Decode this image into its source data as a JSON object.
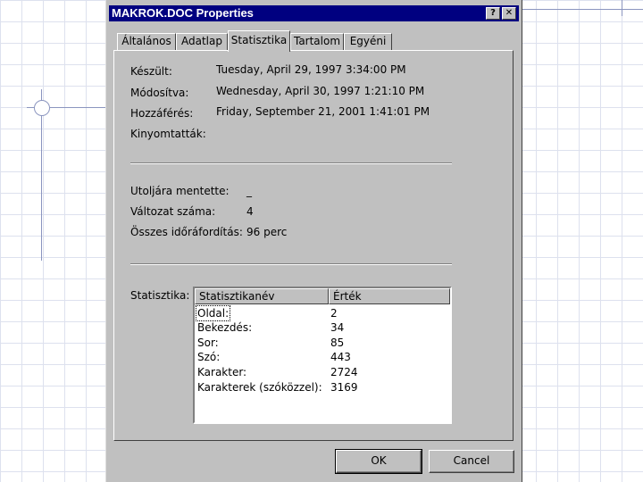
{
  "window": {
    "title": "MAKROK.DOC Properties",
    "help_label": "?",
    "close_label": "✕"
  },
  "tabs": [
    {
      "label": "Általános"
    },
    {
      "label": "Adatlap"
    },
    {
      "label": "Statisztika",
      "active": true
    },
    {
      "label": "Tartalom"
    },
    {
      "label": "Egyéni"
    }
  ],
  "dates": {
    "created_label": "Készült:",
    "created_value": "Tuesday, April 29, 1997 3:34:00 PM",
    "modified_label": "Módosítva:",
    "modified_value": "Wednesday, April 30, 1997 1:21:10 PM",
    "accessed_label": "Hozzáférés:",
    "accessed_value": "Friday, September 21, 2001 1:41:01 PM",
    "printed_label": "Kinyomtatták:",
    "printed_value": ""
  },
  "revision": {
    "last_saved_label": "Utoljára mentette:",
    "last_saved_value": "_",
    "revision_label": "Változat száma:",
    "revision_value": "4",
    "editing_label": "Összes időráfordítás:",
    "editing_value": "96 perc"
  },
  "statistics": {
    "label": "Statisztika:",
    "col_name": "Statisztikanév",
    "col_value": "Érték",
    "rows": [
      {
        "name": "Oldal:",
        "value": "2"
      },
      {
        "name": "Bekezdés:",
        "value": "34"
      },
      {
        "name": "Sor:",
        "value": "85"
      },
      {
        "name": "Szó:",
        "value": "443"
      },
      {
        "name": "Karakter:",
        "value": "2724"
      },
      {
        "name": "Karakterek (szóközzel):",
        "value": "3169"
      }
    ]
  },
  "buttons": {
    "ok_label": "OK",
    "cancel_label": "Cancel"
  }
}
